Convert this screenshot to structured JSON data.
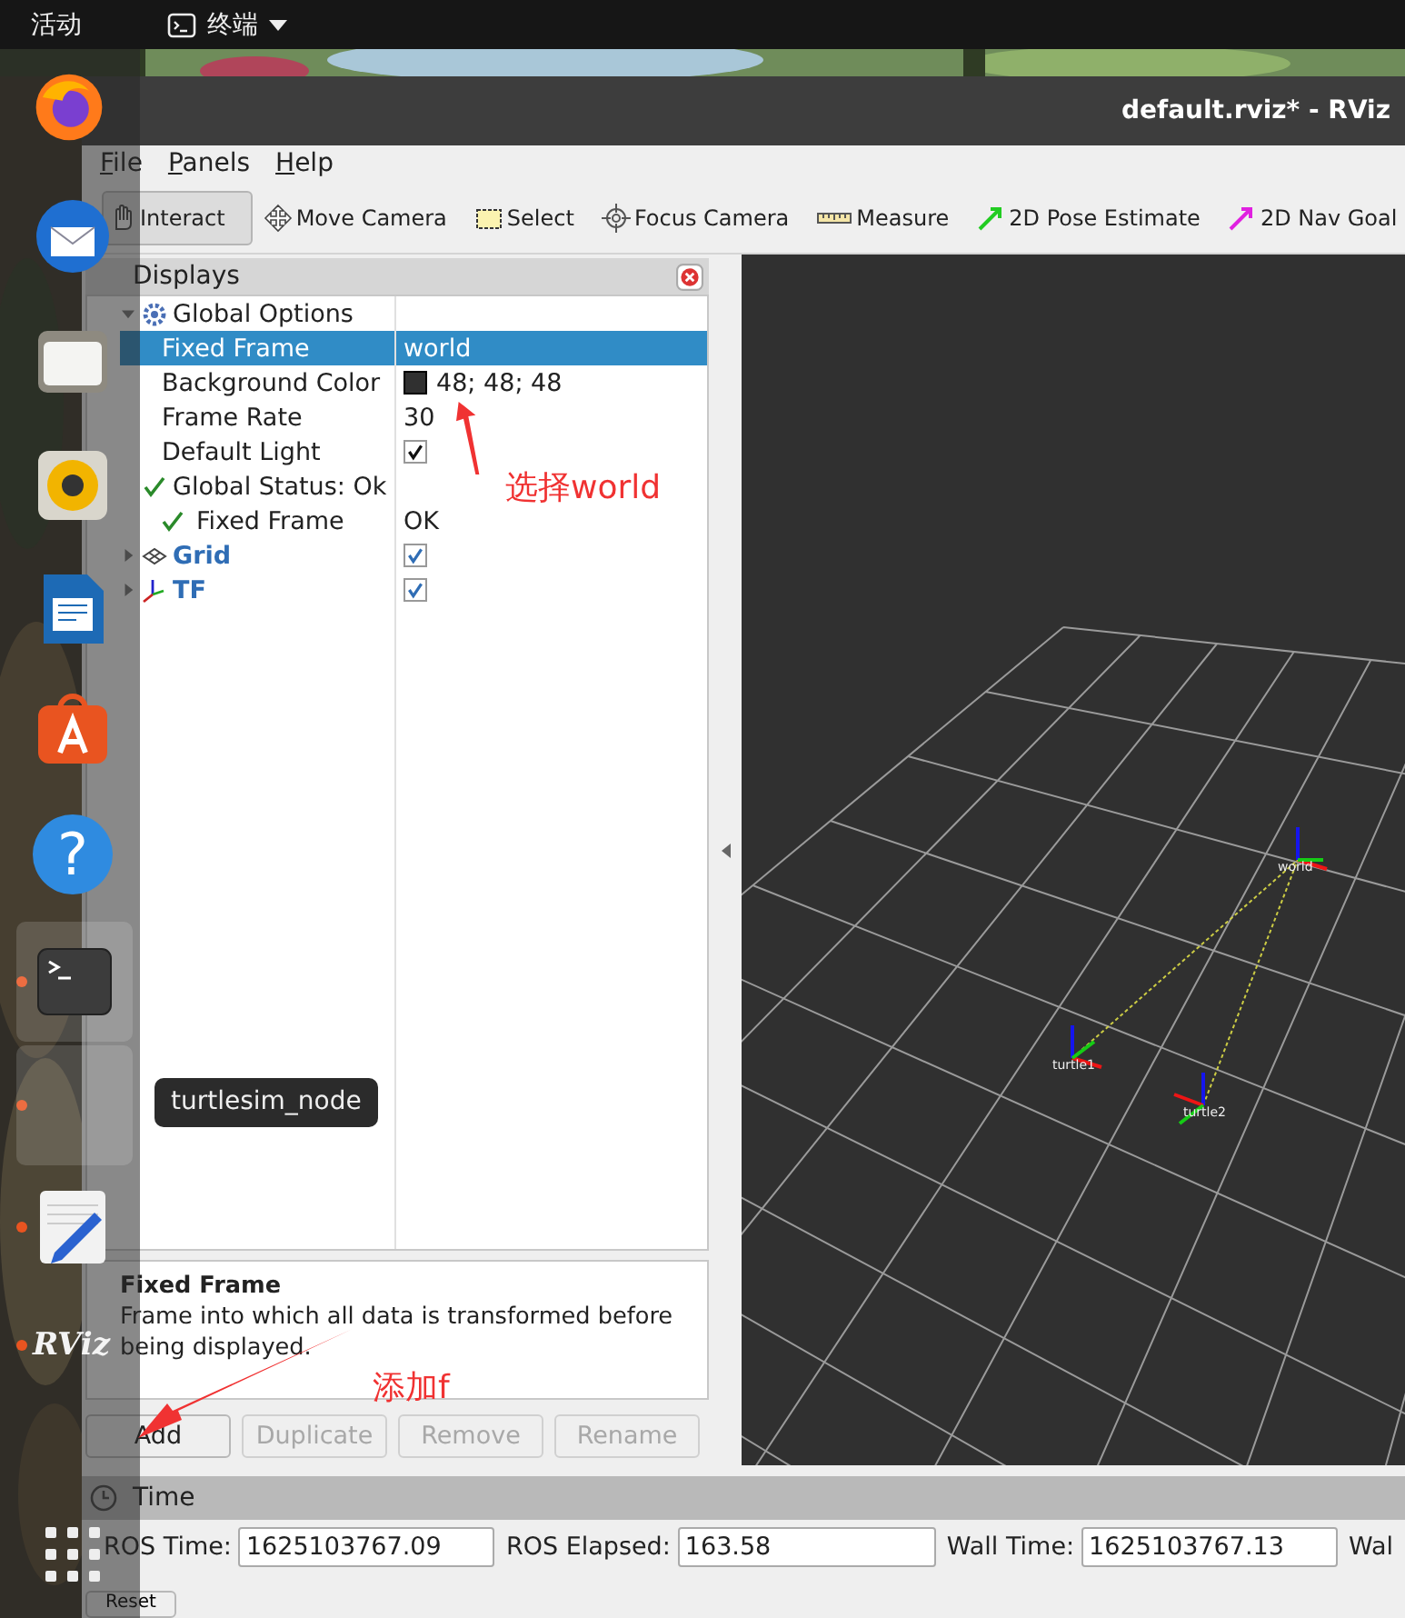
{
  "topbar": {
    "activities": "活动",
    "app": "终端"
  },
  "window": {
    "title": "default.rviz* - RViz"
  },
  "menu": [
    "File",
    "Panels",
    "Help"
  ],
  "tools": [
    {
      "kind": "interact",
      "label": "Interact",
      "selected": true
    },
    {
      "kind": "move",
      "label": "Move Camera",
      "selected": false
    },
    {
      "kind": "select",
      "label": "Select",
      "selected": false
    },
    {
      "kind": "focus",
      "label": "Focus Camera",
      "selected": false
    },
    {
      "kind": "measure",
      "label": "Measure",
      "selected": false
    },
    {
      "kind": "pose",
      "label": "2D Pose Estimate",
      "selected": false
    },
    {
      "kind": "goal",
      "label": "2D Nav Goal",
      "selected": false
    }
  ],
  "displays": {
    "title": "Displays",
    "rows": [
      {
        "kind": "group",
        "label": "Global Options",
        "expanded": true,
        "selected": false,
        "children": [
          {
            "kind": "text",
            "label": "Fixed Frame",
            "value": "world",
            "selected": true
          },
          {
            "kind": "color",
            "label": "Background Color",
            "value": "48; 48; 48",
            "color": "#303030",
            "selected": false
          },
          {
            "kind": "text",
            "label": "Frame Rate",
            "value": "30",
            "selected": false
          },
          {
            "kind": "checkbox",
            "label": "Default Light",
            "checked": true,
            "selected": false
          }
        ]
      },
      {
        "kind": "status",
        "label": "Global Status: Ok",
        "selected": false,
        "children": [
          {
            "kind": "status",
            "label": "Fixed Frame",
            "value": "OK",
            "selected": false
          }
        ]
      },
      {
        "kind": "display",
        "label": "Grid",
        "checked": true,
        "expanded": false,
        "selected": false
      },
      {
        "kind": "display",
        "label": "TF",
        "checked": true,
        "expanded": false,
        "selected": false
      }
    ]
  },
  "description": {
    "title": "Fixed Frame",
    "text": "Frame into which all data is transformed before being displayed."
  },
  "buttons": [
    {
      "label": "Add",
      "disabled": false
    },
    {
      "label": "Duplicate",
      "disabled": true
    },
    {
      "label": "Remove",
      "disabled": true
    },
    {
      "label": "Rename",
      "disabled": true
    }
  ],
  "view": {
    "frames": [
      {
        "name": "world"
      },
      {
        "name": "turtle1"
      },
      {
        "name": "turtle2"
      }
    ]
  },
  "time": {
    "title": "Time",
    "fields": [
      {
        "label": "ROS Time:",
        "value": "1625103767.09"
      },
      {
        "label": "ROS Elapsed:",
        "value": "163.58"
      },
      {
        "label": "Wall Time:",
        "value": "1625103767.13"
      },
      {
        "label": "Wal"
      }
    ],
    "reset": "Reset"
  },
  "dock": {
    "items": [
      {
        "kind": "firefox",
        "selected": false,
        "running": false
      },
      {
        "kind": "mail",
        "selected": false,
        "running": false
      },
      {
        "kind": "files",
        "selected": false,
        "running": false
      },
      {
        "kind": "music",
        "selected": false,
        "running": false
      },
      {
        "kind": "writer",
        "selected": false,
        "running": false
      },
      {
        "kind": "store",
        "selected": false,
        "running": false
      },
      {
        "kind": "help",
        "label": "?",
        "selected": false,
        "running": false
      },
      {
        "kind": "terminal",
        "selected": true,
        "running": true
      },
      {
        "kind": "blank",
        "selected": true,
        "running": true
      },
      {
        "kind": "editor",
        "selected": false,
        "running": true
      },
      {
        "kind": "rviz",
        "label": "RViz",
        "selected": false,
        "running": true
      },
      {
        "kind": "apps",
        "selected": false,
        "running": false
      }
    ],
    "tooltip": "turtlesim_node"
  },
  "annotations": [
    {
      "text": "选择world"
    },
    {
      "text": "添加f"
    }
  ]
}
